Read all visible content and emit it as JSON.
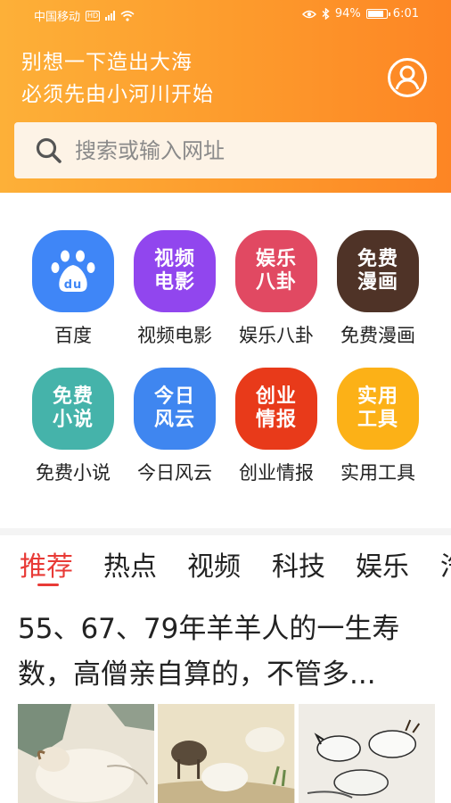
{
  "status_bar": {
    "carrier": "中国移动",
    "hd": "HD",
    "battery": "94%",
    "time": "6:01"
  },
  "header": {
    "slogan_line1": "别想一下造出大海",
    "slogan_line2": "必须先由小河川开始"
  },
  "search": {
    "placeholder": "搜索或输入网址"
  },
  "apps": [
    {
      "label": "百度",
      "icon_text_1": "",
      "icon_text_2": "",
      "color": "#3f86f7"
    },
    {
      "label": "视频电影",
      "icon_text_1": "视频",
      "icon_text_2": "电影",
      "color": "#9146ee"
    },
    {
      "label": "娱乐八卦",
      "icon_text_1": "娱乐",
      "icon_text_2": "八卦",
      "color": "#e14962"
    },
    {
      "label": "免费漫画",
      "icon_text_1": "免费",
      "icon_text_2": "漫画",
      "color": "#4f3327"
    },
    {
      "label": "免费小说",
      "icon_text_1": "免费",
      "icon_text_2": "小说",
      "color": "#45b3aa"
    },
    {
      "label": "今日风云",
      "icon_text_1": "今日",
      "icon_text_2": "风云",
      "color": "#3f86f0"
    },
    {
      "label": "创业情报",
      "icon_text_1": "创业",
      "icon_text_2": "情报",
      "color": "#e83a1a"
    },
    {
      "label": "实用工具",
      "icon_text_1": "实用",
      "icon_text_2": "工具",
      "color": "#fcb117"
    }
  ],
  "tabs": [
    "推荐",
    "热点",
    "视频",
    "科技",
    "娱乐",
    "汽"
  ],
  "article": {
    "title": "55、67、79年羊羊人的一生寿数，高僧亲自算的，不管多..."
  },
  "colors": {
    "accent": "#e83a36",
    "header_start": "#fdb038",
    "header_end": "#fd8524"
  }
}
